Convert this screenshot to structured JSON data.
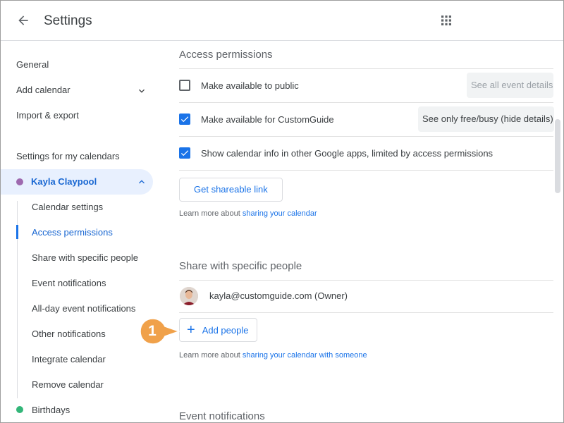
{
  "header": {
    "title": "Settings",
    "back_icon": "arrow-left-icon",
    "apps_icon": "apps-grid-icon"
  },
  "sidebar": {
    "general": "General",
    "add_calendar": "Add calendar",
    "import_export": "Import & export",
    "section_title": "Settings for my calendars",
    "selected_calendar": {
      "name": "Kayla Claypool",
      "color": "#9e69af"
    },
    "sub_items": [
      "Calendar settings",
      "Access permissions",
      "Share with specific people",
      "Event notifications",
      "All-day event notifications",
      "Other notifications",
      "Integrate calendar",
      "Remove calendar"
    ],
    "active_sub_item": "Access permissions",
    "other_calendar": {
      "name": "Birthdays",
      "color": "#33b679"
    }
  },
  "access_permissions": {
    "title": "Access permissions",
    "public": {
      "label": "Make available to public",
      "checked": false,
      "select_value": "See all event details"
    },
    "org": {
      "label": "Make available for CustomGuide",
      "checked": true,
      "select_value": "See only free/busy (hide details)"
    },
    "google_apps": {
      "label": "Show calendar info in other Google apps, limited by access permissions",
      "checked": true
    },
    "shareable_link_button": "Get shareable link",
    "learn_more_prefix": "Learn more about ",
    "learn_more_link": "sharing your calendar"
  },
  "share_specific": {
    "title": "Share with specific people",
    "person": "kayla@customguide.com (Owner)",
    "add_people_button": "Add people",
    "learn_more_prefix": "Learn more about ",
    "learn_more_link": "sharing your calendar with someone"
  },
  "event_notifications": {
    "title": "Event notifications"
  },
  "callout": {
    "number": "1",
    "color": "#f0a14a"
  },
  "colors": {
    "accent": "#1a73e8",
    "selected_bg": "#e8f0fe"
  }
}
